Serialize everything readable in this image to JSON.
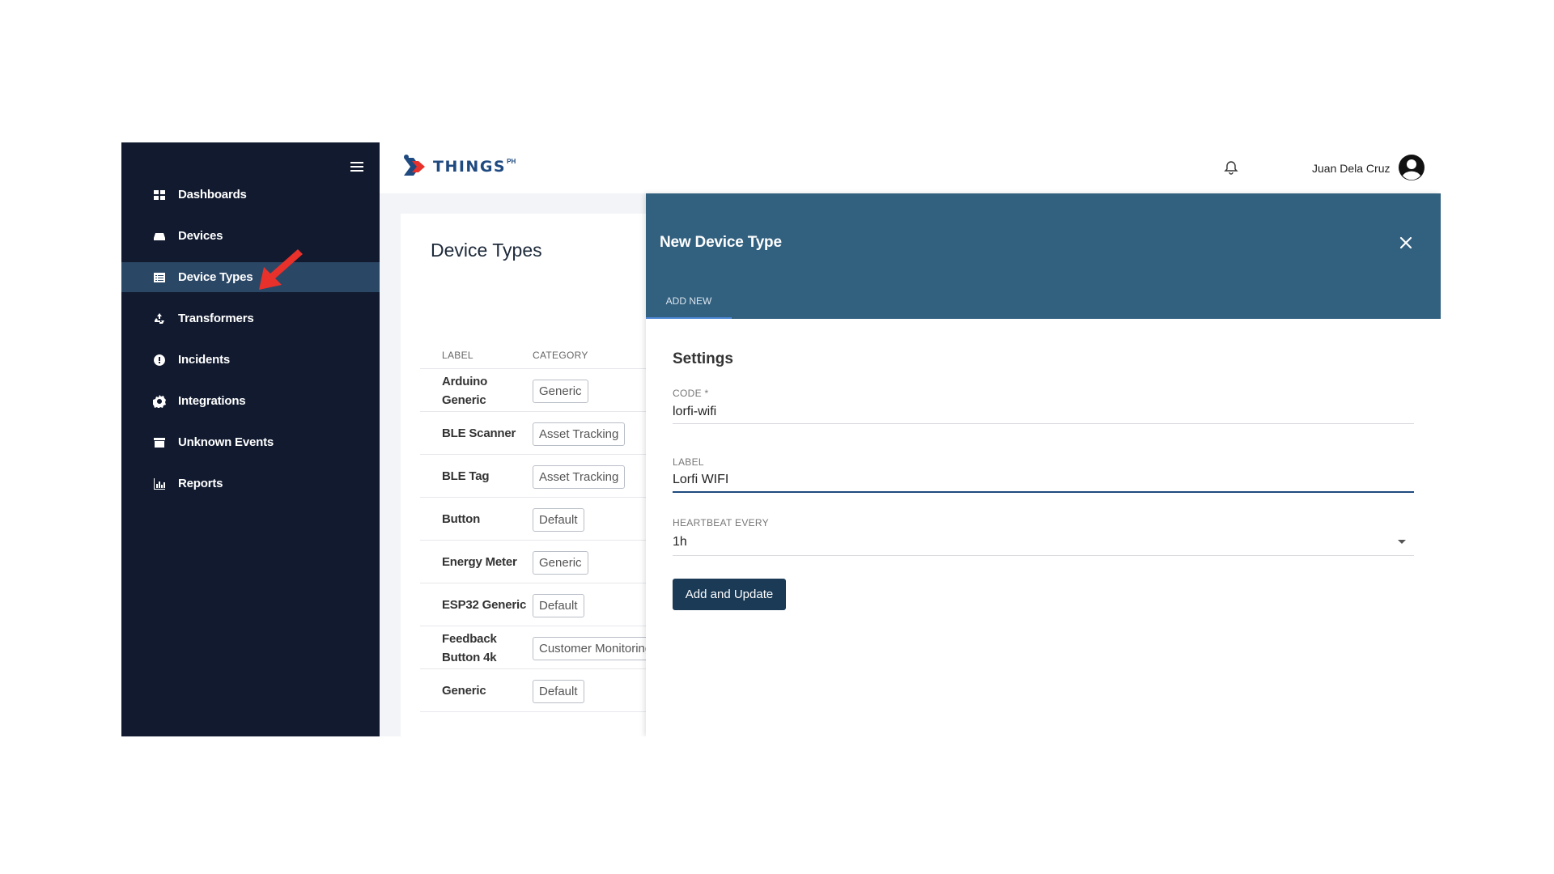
{
  "sidebar": {
    "items": [
      {
        "label": "Dashboards",
        "icon": "dashboard-icon"
      },
      {
        "label": "Devices",
        "icon": "devices-icon"
      },
      {
        "label": "Device Types",
        "icon": "list-icon",
        "active": true
      },
      {
        "label": "Transformers",
        "icon": "recycle-icon"
      },
      {
        "label": "Incidents",
        "icon": "alert-icon"
      },
      {
        "label": "Integrations",
        "icon": "gear-icon"
      },
      {
        "label": "Unknown Events",
        "icon": "archive-icon"
      },
      {
        "label": "Reports",
        "icon": "bar-chart-icon"
      }
    ]
  },
  "header": {
    "logo_text": "THINGS",
    "logo_sup": "PH",
    "user_name": "Juan Dela Cruz"
  },
  "page": {
    "title": "Device Types",
    "columns": [
      "LABEL",
      "CATEGORY"
    ],
    "rows": [
      {
        "label": "Arduino Generic",
        "category": "Generic"
      },
      {
        "label": "BLE Scanner",
        "category": "Asset Tracking"
      },
      {
        "label": "BLE Tag",
        "category": "Asset Tracking"
      },
      {
        "label": "Button",
        "category": "Default"
      },
      {
        "label": "Energy Meter",
        "category": "Generic"
      },
      {
        "label": "ESP32 Generic",
        "category": "Default"
      },
      {
        "label": "Feedback Button 4k",
        "category": "Customer Monitoring"
      },
      {
        "label": "Generic",
        "category": "Default"
      }
    ]
  },
  "drawer": {
    "title": "New Device Type",
    "tab": "ADD NEW",
    "section_title": "Settings",
    "code_label": "CODE *",
    "code_value": "lorfi-wifi",
    "label_label": "LABEL",
    "label_value": "Lorfi WIFI",
    "heartbeat_label": "HEARTBEAT EVERY",
    "heartbeat_value": "1h",
    "submit_label": "Add and Update"
  },
  "colors": {
    "sidebar_bg": "#111a2f",
    "sidebar_active": "#2b4766",
    "drawer_header": "#32607f",
    "button": "#1a3a56",
    "annotation_arrow": "#e8312a"
  }
}
